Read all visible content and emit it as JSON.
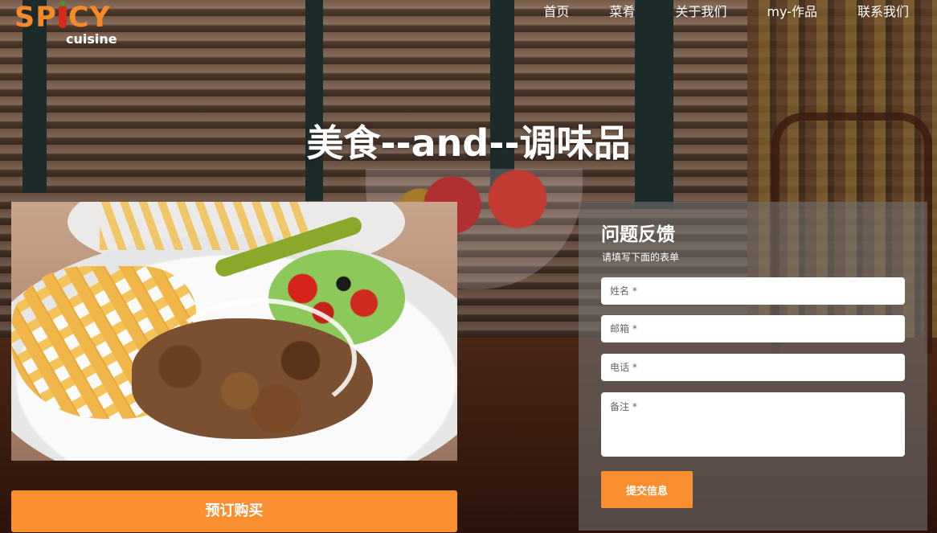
{
  "logo": {
    "word_left": "SP",
    "word_right": "CY",
    "subtitle": "cuisine"
  },
  "nav": [
    {
      "label": "首页"
    },
    {
      "label": "菜肴"
    },
    {
      "label": "关于我们"
    },
    {
      "label": "my-作品"
    },
    {
      "label": "联系我们"
    }
  ],
  "hero": {
    "title": "美食--and--调味品"
  },
  "order_button": {
    "label": "预订购买"
  },
  "feedback": {
    "title": "问题反馈",
    "subtitle": "请填写下面的表单",
    "fields": {
      "name_placeholder": "姓名 *",
      "email_placeholder": "邮箱 *",
      "phone_placeholder": "电话 *",
      "notes_placeholder": "备注 *"
    },
    "submit_label": "提交信息"
  },
  "colors": {
    "accent": "#f98f2e",
    "logo": "#f58a2a"
  }
}
